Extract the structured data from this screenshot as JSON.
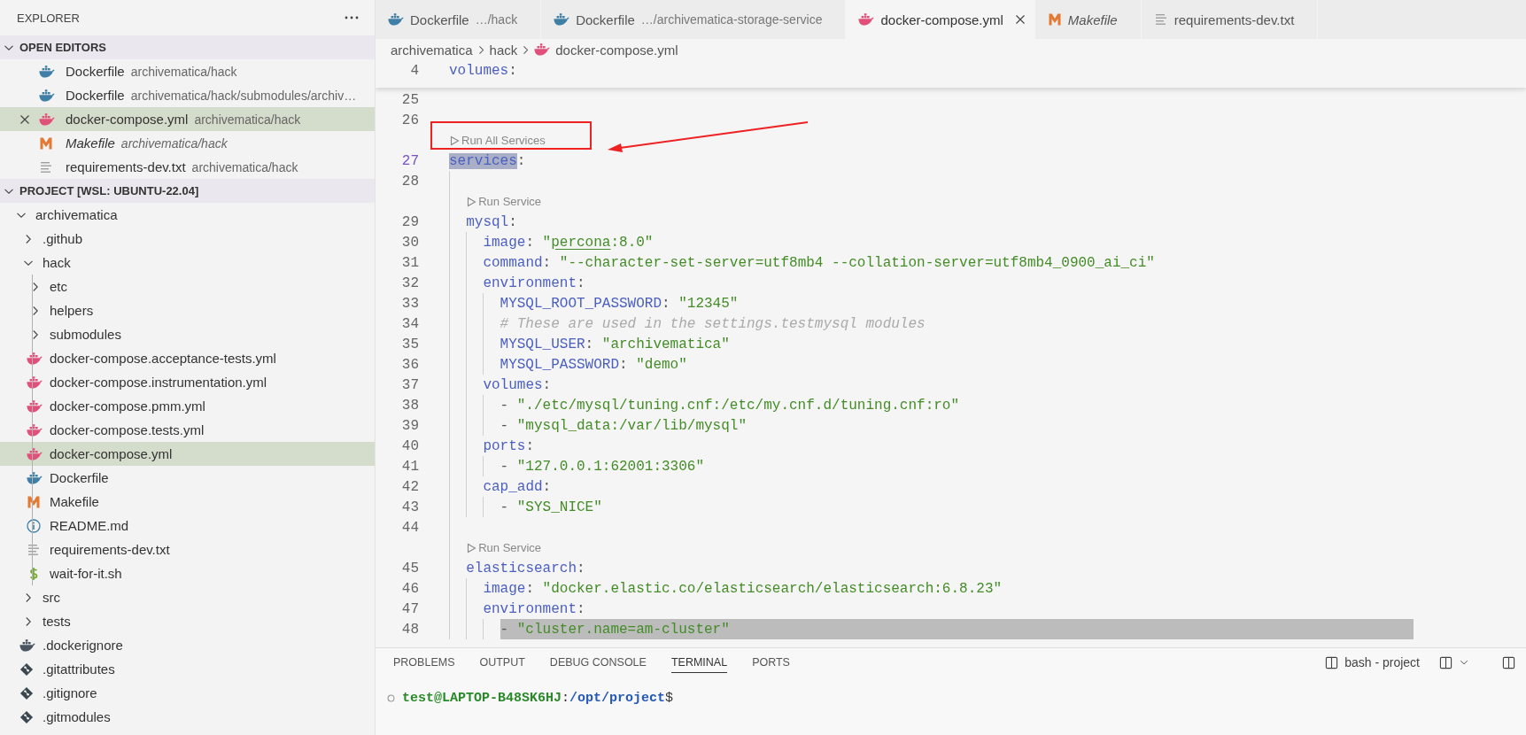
{
  "sidebar": {
    "title": "EXPLORER",
    "open_editors": {
      "title": "OPEN EDITORS",
      "expanded": true,
      "items": [
        {
          "kind": "docker",
          "name": "Dockerfile",
          "path": "archivematica/hack",
          "selected": false,
          "preview": false
        },
        {
          "kind": "docker",
          "name": "Dockerfile",
          "path": "archivematica/hack/submodules/archiv…",
          "selected": false,
          "preview": false
        },
        {
          "kind": "docker-compose",
          "name": "docker-compose.yml",
          "path": "archivematica/hack",
          "selected": true,
          "preview": false
        },
        {
          "kind": "makefile",
          "name": "Makefile",
          "path": "archivematica/hack",
          "selected": false,
          "preview": true
        },
        {
          "kind": "text",
          "name": "requirements-dev.txt",
          "path": "archivematica/hack",
          "selected": false,
          "preview": false
        }
      ]
    },
    "project": {
      "title": "PROJECT [WSL: UBUNTU-22.04]",
      "expanded": true,
      "tree": [
        {
          "kind": "folder",
          "name": "archivematica",
          "expanded": true,
          "selected": false,
          "children": [
            {
              "kind": "folder",
              "name": ".github",
              "expanded": false,
              "selected": false
            },
            {
              "kind": "folder",
              "name": "hack",
              "expanded": true,
              "selected": false,
              "children": [
                {
                  "kind": "folder",
                  "name": "etc",
                  "expanded": false,
                  "selected": false
                },
                {
                  "kind": "folder",
                  "name": "helpers",
                  "expanded": false,
                  "selected": false
                },
                {
                  "kind": "folder",
                  "name": "submodules",
                  "expanded": false,
                  "selected": false
                },
                {
                  "kind": "docker-compose",
                  "name": "docker-compose.acceptance-tests.yml",
                  "selected": false
                },
                {
                  "kind": "docker-compose",
                  "name": "docker-compose.instrumentation.yml",
                  "selected": false
                },
                {
                  "kind": "docker-compose",
                  "name": "docker-compose.pmm.yml",
                  "selected": false
                },
                {
                  "kind": "docker-compose",
                  "name": "docker-compose.tests.yml",
                  "selected": false
                },
                {
                  "kind": "docker-compose",
                  "name": "docker-compose.yml",
                  "selected": true
                },
                {
                  "kind": "docker",
                  "name": "Dockerfile",
                  "selected": false
                },
                {
                  "kind": "makefile",
                  "name": "Makefile",
                  "selected": false
                },
                {
                  "kind": "info",
                  "name": "README.md",
                  "selected": false
                },
                {
                  "kind": "text",
                  "name": "requirements-dev.txt",
                  "selected": false
                },
                {
                  "kind": "shell",
                  "name": "wait-for-it.sh",
                  "selected": false
                }
              ]
            },
            {
              "kind": "folder",
              "name": "src",
              "expanded": false,
              "selected": false
            },
            {
              "kind": "folder",
              "name": "tests",
              "expanded": false,
              "selected": false
            },
            {
              "kind": "docker-ignore",
              "name": ".dockerignore",
              "selected": false
            },
            {
              "kind": "git",
              "name": ".gitattributes",
              "selected": false
            },
            {
              "kind": "git",
              "name": ".gitignore",
              "selected": false
            },
            {
              "kind": "git",
              "name": ".gitmodules",
              "selected": false
            }
          ]
        }
      ]
    }
  },
  "editor": {
    "tabs": [
      {
        "kind": "docker",
        "label": "Dockerfile",
        "description": "…/hack",
        "selected": false,
        "preview": false
      },
      {
        "kind": "docker",
        "label": "Dockerfile",
        "description": "…/archivematica-storage-service",
        "selected": false,
        "preview": false
      },
      {
        "kind": "docker-compose",
        "label": "docker-compose.yml",
        "selected": true,
        "preview": false
      },
      {
        "kind": "makefile",
        "label": "Makefile",
        "selected": false,
        "preview": true
      },
      {
        "kind": "text",
        "label": "requirements-dev.txt",
        "selected": false,
        "preview": false
      }
    ],
    "breadcrumb": [
      {
        "kind": "folder",
        "text": "archivematica"
      },
      {
        "kind": "folder",
        "text": "hack"
      },
      {
        "kind": "docker-compose",
        "text": "docker-compose.yml"
      }
    ],
    "sticky_lines": [
      {
        "number": "4",
        "tokens": [
          {
            "kind": "key",
            "text": "volumes"
          },
          {
            "kind": "punct",
            "text": ":"
          }
        ]
      }
    ],
    "lines": [
      {
        "kind": "code",
        "number": "25",
        "current": false,
        "highlighted": false
      },
      {
        "kind": "code",
        "number": "26",
        "current": false,
        "highlighted": false
      },
      {
        "kind": "codelens",
        "text": "Run All Services"
      },
      {
        "kind": "code",
        "number": "27",
        "current": true,
        "highlighted": false,
        "match": true,
        "tokens": [
          {
            "kind": "key",
            "text": "services"
          },
          {
            "kind": "punct",
            "text": ":"
          }
        ],
        "children": [
          {
            "kind": "code",
            "number": "28",
            "current": false,
            "highlighted": false
          },
          {
            "kind": "codelens",
            "text": "Run Service"
          },
          {
            "kind": "code",
            "number": "29",
            "current": false,
            "highlighted": false,
            "match": false,
            "tokens": [
              {
                "kind": "key",
                "text": "mysql"
              },
              {
                "kind": "punct",
                "text": ":"
              }
            ],
            "children": [
              {
                "kind": "code",
                "number": "30",
                "current": false,
                "highlighted": false,
                "match": false,
                "tokens": [
                  {
                    "kind": "key",
                    "text": "image"
                  },
                  {
                    "kind": "punct",
                    "text": ": "
                  },
                  {
                    "kind": "string",
                    "text": "\""
                  },
                  {
                    "kind": "link",
                    "text": "percona"
                  },
                  {
                    "kind": "string",
                    "text": ":8.0\""
                  }
                ]
              },
              {
                "kind": "code",
                "number": "31",
                "current": false,
                "highlighted": false,
                "match": false,
                "tokens": [
                  {
                    "kind": "key",
                    "text": "command"
                  },
                  {
                    "kind": "punct",
                    "text": ": "
                  },
                  {
                    "kind": "string",
                    "text": "\"--character-set-server=utf8mb4 --collation-server=utf8mb4_0900_ai_ci\""
                  }
                ]
              },
              {
                "kind": "code",
                "number": "32",
                "current": false,
                "highlighted": false,
                "match": false,
                "tokens": [
                  {
                    "kind": "key",
                    "text": "environment"
                  },
                  {
                    "kind": "punct",
                    "text": ":"
                  }
                ],
                "children": [
                  {
                    "kind": "code",
                    "number": "33",
                    "current": false,
                    "highlighted": false,
                    "match": false,
                    "tokens": [
                      {
                        "kind": "key",
                        "text": "MYSQL_ROOT_PASSWORD"
                      },
                      {
                        "kind": "punct",
                        "text": ": "
                      },
                      {
                        "kind": "string",
                        "text": "\"12345\""
                      }
                    ]
                  },
                  {
                    "kind": "code",
                    "number": "34",
                    "current": false,
                    "highlighted": false,
                    "match": false,
                    "tokens": [
                      {
                        "kind": "comment",
                        "text": "# These are used in the settings.testmysql modules"
                      }
                    ]
                  },
                  {
                    "kind": "code",
                    "number": "35",
                    "current": false,
                    "highlighted": false,
                    "match": false,
                    "tokens": [
                      {
                        "kind": "key",
                        "text": "MYSQL_USER"
                      },
                      {
                        "kind": "punct",
                        "text": ": "
                      },
                      {
                        "kind": "string",
                        "text": "\"archivematica\""
                      }
                    ]
                  },
                  {
                    "kind": "code",
                    "number": "36",
                    "current": false,
                    "highlighted": false,
                    "match": false,
                    "tokens": [
                      {
                        "kind": "key",
                        "text": "MYSQL_PASSWORD"
                      },
                      {
                        "kind": "punct",
                        "text": ": "
                      },
                      {
                        "kind": "string",
                        "text": "\"demo\""
                      }
                    ]
                  }
                ]
              },
              {
                "kind": "code",
                "number": "37",
                "current": false,
                "highlighted": false,
                "match": false,
                "tokens": [
                  {
                    "kind": "key",
                    "text": "volumes"
                  },
                  {
                    "kind": "punct",
                    "text": ":"
                  }
                ],
                "children": [
                  {
                    "kind": "code",
                    "number": "38",
                    "current": false,
                    "highlighted": false,
                    "match": false,
                    "tokens": [
                      {
                        "kind": "punct",
                        "text": "- "
                      },
                      {
                        "kind": "string",
                        "text": "\"./etc/mysql/tuning.cnf:/etc/my.cnf.d/tuning.cnf:ro\""
                      }
                    ]
                  },
                  {
                    "kind": "code",
                    "number": "39",
                    "current": false,
                    "highlighted": false,
                    "match": false,
                    "tokens": [
                      {
                        "kind": "punct",
                        "text": "- "
                      },
                      {
                        "kind": "string",
                        "text": "\"mysql_data:/var/lib/mysql\""
                      }
                    ]
                  }
                ]
              },
              {
                "kind": "code",
                "number": "40",
                "current": false,
                "highlighted": false,
                "match": false,
                "tokens": [
                  {
                    "kind": "key",
                    "text": "ports"
                  },
                  {
                    "kind": "punct",
                    "text": ":"
                  }
                ],
                "children": [
                  {
                    "kind": "code",
                    "number": "41",
                    "current": false,
                    "highlighted": false,
                    "match": false,
                    "tokens": [
                      {
                        "kind": "punct",
                        "text": "- "
                      },
                      {
                        "kind": "string",
                        "text": "\"127.0.0.1:62001:3306\""
                      }
                    ]
                  }
                ]
              },
              {
                "kind": "code",
                "number": "42",
                "current": false,
                "highlighted": false,
                "match": false,
                "tokens": [
                  {
                    "kind": "key",
                    "text": "cap_add"
                  },
                  {
                    "kind": "punct",
                    "text": ":"
                  }
                ],
                "children": [
                  {
                    "kind": "code",
                    "number": "43",
                    "current": false,
                    "highlighted": false,
                    "match": false,
                    "tokens": [
                      {
                        "kind": "punct",
                        "text": "- "
                      },
                      {
                        "kind": "string",
                        "text": "\"SYS_NICE\""
                      }
                    ]
                  }
                ]
              }
            ]
          },
          {
            "kind": "code",
            "number": "44",
            "current": false,
            "highlighted": false
          },
          {
            "kind": "codelens",
            "text": "Run Service"
          },
          {
            "kind": "code",
            "number": "45",
            "current": false,
            "highlighted": false,
            "match": false,
            "tokens": [
              {
                "kind": "key",
                "text": "elasticsearch"
              },
              {
                "kind": "punct",
                "text": ":"
              }
            ],
            "children": [
              {
                "kind": "code",
                "number": "46",
                "current": false,
                "highlighted": false,
                "match": false,
                "tokens": [
                  {
                    "kind": "key",
                    "text": "image"
                  },
                  {
                    "kind": "punct",
                    "text": ": "
                  },
                  {
                    "kind": "string",
                    "text": "\"docker.elastic.co/elasticsearch/elasticsearch:6.8.23\""
                  }
                ]
              },
              {
                "kind": "code",
                "number": "47",
                "current": false,
                "highlighted": false,
                "match": false,
                "tokens": [
                  {
                    "kind": "key",
                    "text": "environment"
                  },
                  {
                    "kind": "punct",
                    "text": ":"
                  }
                ],
                "children": [
                  {
                    "kind": "code",
                    "number": "48",
                    "current": false,
                    "highlighted": true,
                    "match": false,
                    "tokens": [
                      {
                        "kind": "punct",
                        "text": "- "
                      },
                      {
                        "kind": "string",
                        "text": "\"cluster.name=am-cluster\""
                      }
                    ]
                  }
                ]
              }
            ]
          }
        ]
      }
    ]
  },
  "panel": {
    "tabs": [
      {
        "label": "PROBLEMS",
        "selected": false
      },
      {
        "label": "OUTPUT",
        "selected": false
      },
      {
        "label": "DEBUG CONSOLE",
        "selected": false
      },
      {
        "label": "TERMINAL",
        "selected": true
      },
      {
        "label": "PORTS",
        "selected": false
      }
    ],
    "terminal_name": "bash - project",
    "terminal_lines": [
      {
        "parts": [
          {
            "kind": "user",
            "text": "test@LAPTOP-B48SK6HJ"
          },
          {
            "kind": "plain",
            "text": ":"
          },
          {
            "kind": "path",
            "text": "/opt/project"
          },
          {
            "kind": "plain",
            "text": "$"
          }
        ]
      }
    ]
  }
}
